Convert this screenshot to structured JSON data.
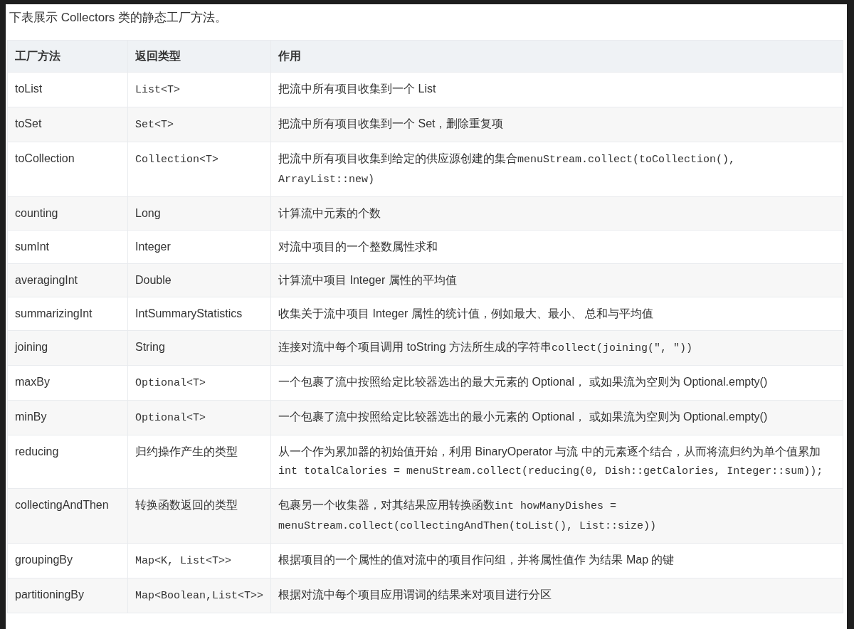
{
  "intro": "下表展示 Collectors 类的静态工厂方法。",
  "table": {
    "columns": [
      "工厂方法",
      "返回类型",
      "作用"
    ],
    "rows": [
      {
        "method": "toList",
        "return_type": {
          "kind": "code",
          "text": "List<T>"
        },
        "description": [
          {
            "kind": "text",
            "text": "把流中所有项目收集到一个 List"
          }
        ]
      },
      {
        "method": "toSet",
        "return_type": {
          "kind": "code",
          "text": "Set<T>"
        },
        "description": [
          {
            "kind": "text",
            "text": "把流中所有项目收集到一个 Set，删除重复项"
          }
        ]
      },
      {
        "method": "toCollection",
        "return_type": {
          "kind": "code",
          "text": "Collection<T>"
        },
        "description": [
          {
            "kind": "text",
            "text": "把流中所有项目收集到给定的供应源创建的集合"
          },
          {
            "kind": "code",
            "text": "menuStream.collect(toCollection(), ArrayList::new)"
          }
        ]
      },
      {
        "method": "counting",
        "return_type": {
          "kind": "text",
          "text": "Long"
        },
        "description": [
          {
            "kind": "text",
            "text": "计算流中元素的个数"
          }
        ]
      },
      {
        "method": "sumInt",
        "return_type": {
          "kind": "text",
          "text": "Integer"
        },
        "description": [
          {
            "kind": "text",
            "text": "对流中项目的一个整数属性求和"
          }
        ]
      },
      {
        "method": "averagingInt",
        "return_type": {
          "kind": "text",
          "text": "Double"
        },
        "description": [
          {
            "kind": "text",
            "text": "计算流中项目 Integer 属性的平均值"
          }
        ]
      },
      {
        "method": "summarizingInt",
        "return_type": {
          "kind": "text",
          "text": "IntSummaryStatistics"
        },
        "description": [
          {
            "kind": "text",
            "text": "收集关于流中项目 Integer 属性的统计值，例如最大、最小、 总和与平均值"
          }
        ]
      },
      {
        "method": "joining",
        "return_type": {
          "kind": "text",
          "text": "String"
        },
        "description": [
          {
            "kind": "text",
            "text": "连接对流中每个项目调用 toString 方法所生成的字符串"
          },
          {
            "kind": "code",
            "text": "collect(joining(\", \"))"
          }
        ]
      },
      {
        "method": "maxBy",
        "return_type": {
          "kind": "code",
          "text": "Optional<T>"
        },
        "description": [
          {
            "kind": "text",
            "text": "一个包裹了流中按照给定比较器选出的最大元素的 Optional， 或如果流为空则为 Optional.empty()"
          }
        ]
      },
      {
        "method": "minBy",
        "return_type": {
          "kind": "code",
          "text": "Optional<T>"
        },
        "description": [
          {
            "kind": "text",
            "text": "一个包裹了流中按照给定比较器选出的最小元素的 Optional， 或如果流为空则为 Optional.empty()"
          }
        ]
      },
      {
        "method": "reducing",
        "return_type": {
          "kind": "text",
          "text": "归约操作产生的类型"
        },
        "description": [
          {
            "kind": "text",
            "text": "从一个作为累加器的初始值开始，利用 BinaryOperator 与流 中的元素逐个结合，从而将流归约为单个值累加"
          },
          {
            "kind": "code",
            "text": "int totalCalories = menuStream.collect(reducing(0, Dish::getCalories, Integer::sum));"
          }
        ]
      },
      {
        "method": "collectingAndThen",
        "return_type": {
          "kind": "text",
          "text": "转换函数返回的类型"
        },
        "description": [
          {
            "kind": "text",
            "text": "包裹另一个收集器，对其结果应用转换函数"
          },
          {
            "kind": "code",
            "text": "int howManyDishes = menuStream.collect(collectingAndThen(toList(), List::size))"
          }
        ]
      },
      {
        "method": "groupingBy",
        "return_type": {
          "kind": "code",
          "text": "Map<K, List<T>>"
        },
        "description": [
          {
            "kind": "text",
            "text": "根据项目的一个属性的值对流中的项目作问组，并将属性值作 为结果 Map 的键"
          }
        ]
      },
      {
        "method": "partitioningBy",
        "return_type": {
          "kind": "code",
          "text": "Map<Boolean,List<T>>"
        },
        "description": [
          {
            "kind": "text",
            "text": "根据对流中每个项目应用谓词的结果来对项目进行分区"
          }
        ]
      }
    ]
  }
}
